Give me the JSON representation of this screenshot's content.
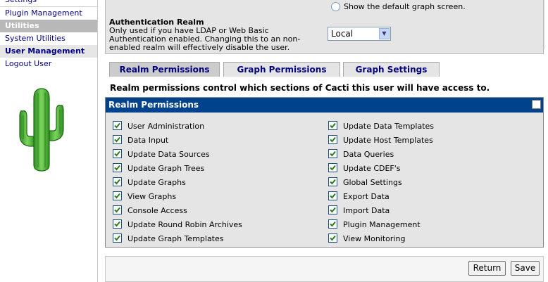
{
  "sidebar": {
    "items": [
      {
        "label": "Settings"
      },
      {
        "label": "Plugin Management"
      },
      {
        "label": "Utilities"
      },
      {
        "label": "System Utilities"
      },
      {
        "label": "User Management"
      },
      {
        "label": "Logout User"
      }
    ]
  },
  "auth": {
    "default_graph_label": "Show the default graph screen.",
    "title": "Authentication Realm",
    "description": "Only used if you have LDAP or Web Basic Authentication enabled. Changing this to an non-enabled realm will effectively disable the user.",
    "realm_value": "Local"
  },
  "tabs": [
    {
      "label": "Realm Permissions",
      "active": true
    },
    {
      "label": "Graph Permissions",
      "active": false
    },
    {
      "label": "Graph Settings",
      "active": false
    }
  ],
  "realm_intro": "Realm permissions control which sections of Cacti this user will have access to.",
  "permissions": {
    "title": "Realm Permissions",
    "left": [
      {
        "label": "User Administration",
        "checked": true
      },
      {
        "label": "Data Input",
        "checked": true
      },
      {
        "label": "Update Data Sources",
        "checked": true
      },
      {
        "label": "Update Graph Trees",
        "checked": true
      },
      {
        "label": "Update Graphs",
        "checked": true
      },
      {
        "label": "View Graphs",
        "checked": true
      },
      {
        "label": "Console Access",
        "checked": true
      },
      {
        "label": "Update Round Robin Archives",
        "checked": true
      },
      {
        "label": "Update Graph Templates",
        "checked": true
      }
    ],
    "right": [
      {
        "label": "Update Data Templates",
        "checked": true
      },
      {
        "label": "Update Host Templates",
        "checked": true
      },
      {
        "label": "Data Queries",
        "checked": true
      },
      {
        "label": "Update CDEF's",
        "checked": true
      },
      {
        "label": "Global Settings",
        "checked": true
      },
      {
        "label": "Export Data",
        "checked": true
      },
      {
        "label": "Import Data",
        "checked": true
      },
      {
        "label": "Plugin Management",
        "checked": true
      },
      {
        "label": "View Monitoring",
        "checked": true
      }
    ]
  },
  "buttons": {
    "return_label": "Return",
    "save_label": "Save"
  },
  "colors": {
    "header_blue": "#00438c",
    "link_navy": "#000080",
    "panel_grey": "#e5e5e5",
    "check_green": "#2e7d1e",
    "cactus_green": "#4caf3a"
  }
}
